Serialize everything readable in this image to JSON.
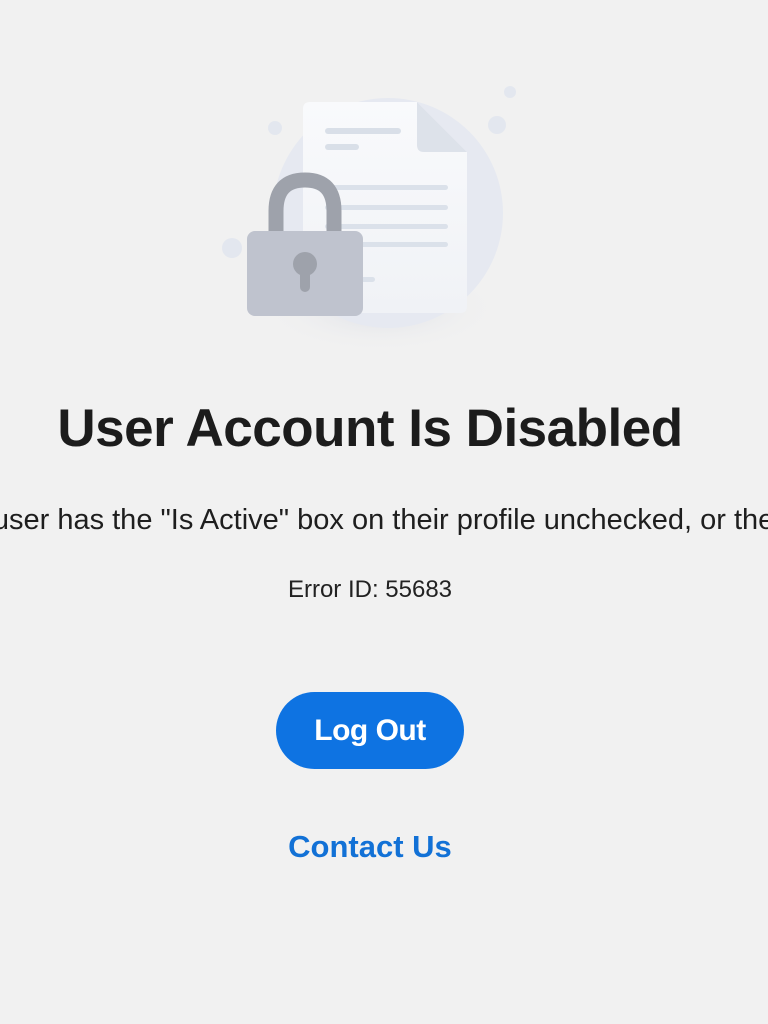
{
  "illustration": {
    "icon": "locked-document-illustration"
  },
  "page_title": "User Account Is Disabled",
  "message": "This user has the \"Is Active\" box on their profile unchecked, or the \"Disabled\" box checked.",
  "error_id": "Error ID: 55683",
  "logout_label": "Log Out",
  "contact_label": "Contact Us",
  "colors": {
    "background": "#f1f1f1",
    "primary": "#0e73e2",
    "link": "#1271d6",
    "title": "#1c1c1c"
  }
}
